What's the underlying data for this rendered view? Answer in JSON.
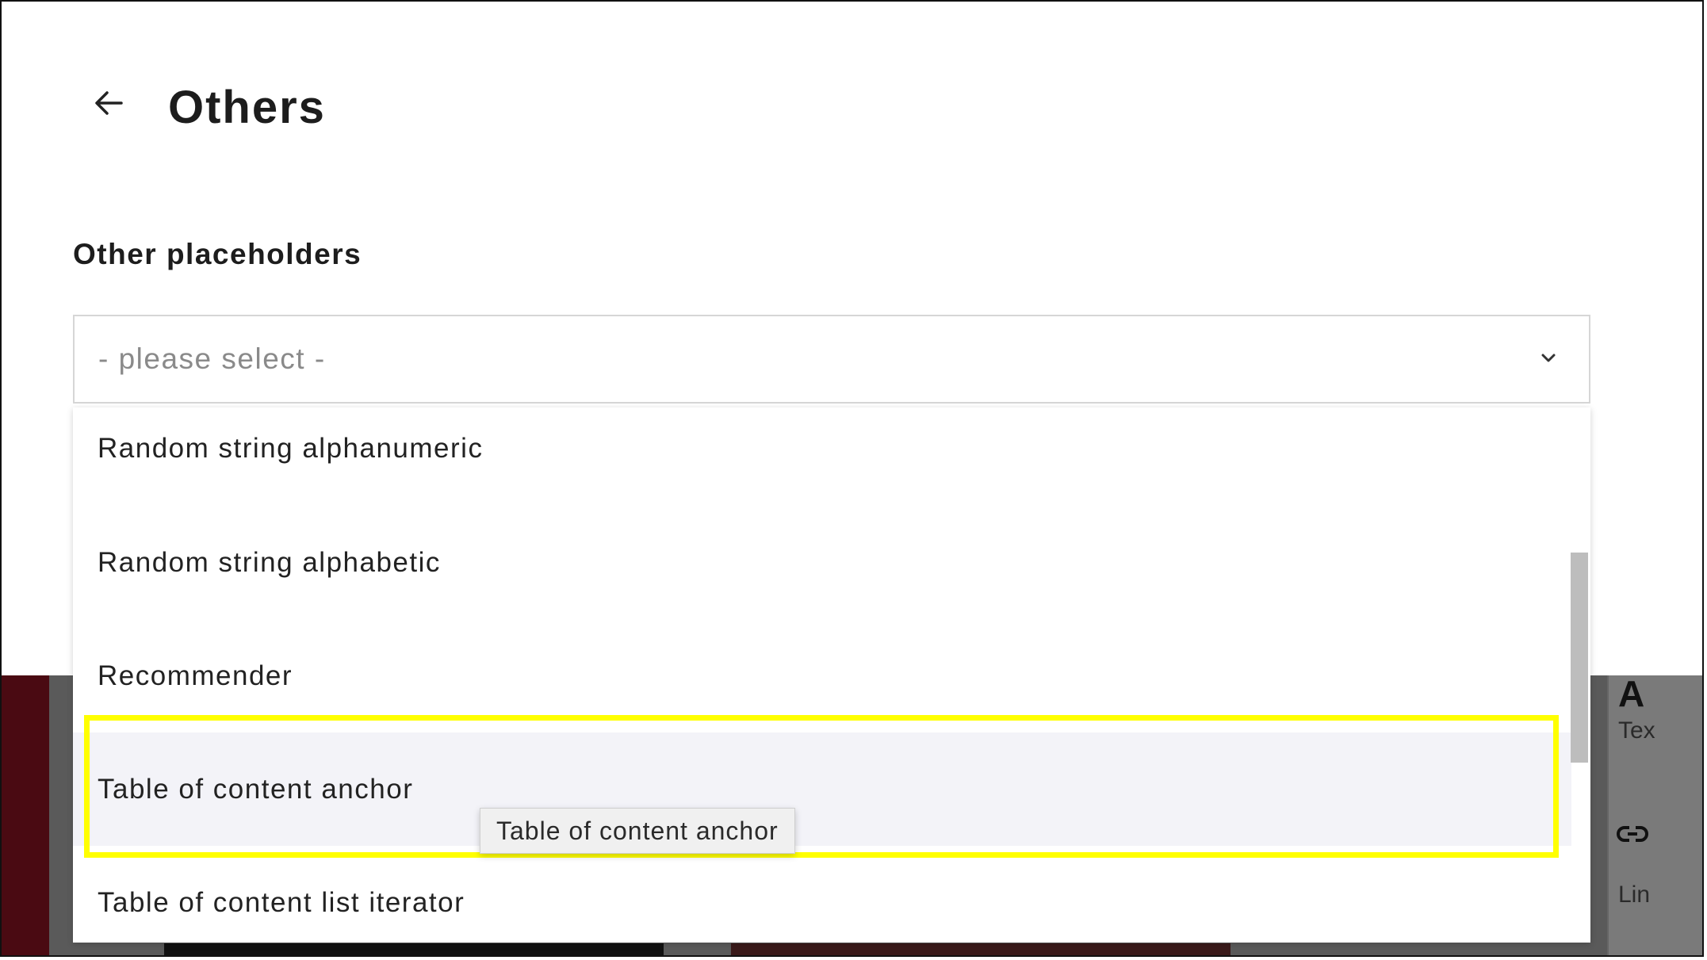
{
  "header": {
    "title": "Others",
    "back_icon": "arrow-left-icon"
  },
  "section": {
    "label": "Other placeholders"
  },
  "select": {
    "placeholder": "- please select -",
    "chevron_icon": "chevron-down-icon",
    "options": [
      "Random string alphanumeric",
      "Random string alphabetic",
      "Recommender",
      "Table of content anchor",
      "Table of content list iterator"
    ],
    "hovered_option": "Table of content anchor"
  },
  "tooltip": {
    "text": "Table of content anchor"
  },
  "background_page": {
    "right_panel_letter": "A",
    "right_panel_text_1": "Tex",
    "right_panel_link_icon": "link-icon",
    "right_panel_text_2": "Lin"
  },
  "colors": {
    "highlight": "#ffff00",
    "hover_bg": "#f3f3f8",
    "placeholder": "#8a8a8a",
    "bg_dark_red": "#4a0a12"
  }
}
